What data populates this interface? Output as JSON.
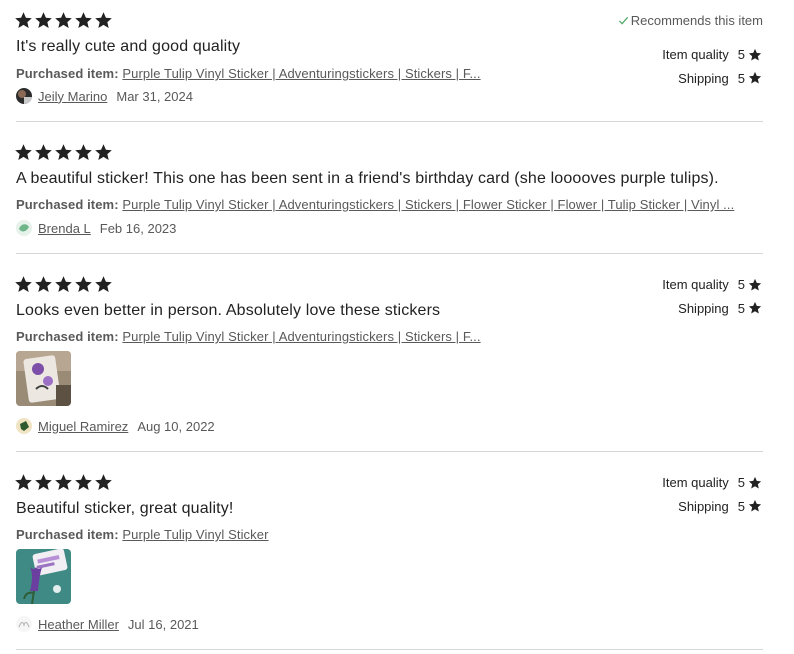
{
  "reviews": [
    {
      "rating": 5,
      "recommends": "Recommends this item",
      "title": "It's really cute and good quality",
      "purchased_label": "Purchased item:",
      "purchased_item": "Purple Tulip Vinyl Sticker | Adventuringstickers | Stickers | F...",
      "author": "Jeily Marino",
      "date": "Mar 31, 2024",
      "item_quality_label": "Item quality",
      "item_quality_value": "5",
      "shipping_label": "Shipping",
      "shipping_value": "5"
    },
    {
      "rating": 5,
      "title": "A beautiful sticker! This one has been sent in a friend's birthday card (she looooves purple tulips).",
      "purchased_label": "Purchased item:",
      "purchased_item": "Purple Tulip Vinyl Sticker | Adventuringstickers | Stickers | Flower Sticker | Flower | Tulip Sticker | Vinyl ...",
      "author": "Brenda L",
      "date": "Feb 16, 2023"
    },
    {
      "rating": 5,
      "title": "Looks even better in person. Absolutely love these stickers",
      "purchased_label": "Purchased item:",
      "purchased_item": "Purple Tulip Vinyl Sticker | Adventuringstickers | Stickers | F...",
      "author": "Miguel Ramirez",
      "date": "Aug 10, 2022",
      "item_quality_label": "Item quality",
      "item_quality_value": "5",
      "shipping_label": "Shipping",
      "shipping_value": "5"
    },
    {
      "rating": 5,
      "title": "Beautiful sticker, great quality!",
      "purchased_label": "Purchased item:",
      "purchased_item": "Purple Tulip Vinyl Sticker",
      "author": "Heather Miller",
      "date": "Jul 16, 2021",
      "item_quality_label": "Item quality",
      "item_quality_value": "5",
      "shipping_label": "Shipping",
      "shipping_value": "5"
    }
  ],
  "colors": {
    "text": "#222222",
    "muted": "#595959",
    "divider": "#d6d6d6",
    "check": "#54a96a"
  },
  "icons": {
    "star": "star-icon",
    "check": "check-icon"
  }
}
